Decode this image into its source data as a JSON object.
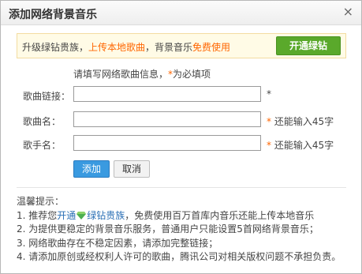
{
  "dialog": {
    "title": "添加网络背景音乐",
    "close_glyph": "×"
  },
  "promo": {
    "text_before": "升级绿钻贵族，",
    "upload_link": "上传本地歌曲",
    "text_middle": "，背景音乐",
    "free_text": "免费使用",
    "button_label": "开通绿钻"
  },
  "form": {
    "hint_prefix": "请填写网络歌曲信息，",
    "hint_star": "*",
    "hint_suffix": "为必填项",
    "song_link_label": "歌曲链接：",
    "song_link_value": "",
    "song_name_label": "歌曲名：",
    "song_name_value": "",
    "singer_label": "歌手名：",
    "singer_value": "",
    "required_star": "*",
    "remaining_text": "还能输入45字",
    "add_button": "添加",
    "cancel_button": "取消"
  },
  "tips": {
    "heading": "温馨提示：",
    "line1_prefix": "1. 推荐您",
    "line1_link1": "开通",
    "line1_link2": "绿钻贵族",
    "line1_suffix": "，免费使用百万首库内音乐还能上传本地音乐",
    "line2": "2. 为提供更稳定的背景音乐服务，普通用户只能设置5首网络背景音乐；",
    "line3": "3. 网络歌曲存在不稳定因素，请添加完整链接；",
    "line4": "4. 请添加原创或经权利人许可的歌曲，腾讯公司对相关版权问题不承担负责。"
  },
  "icons": {
    "close": "close-icon",
    "gem": "green-diamond-icon"
  },
  "colors": {
    "accent_orange": "#ff6600",
    "green_button": "#5aa92b",
    "blue_button": "#3a9ae0",
    "link_blue": "#2a6fb5"
  }
}
